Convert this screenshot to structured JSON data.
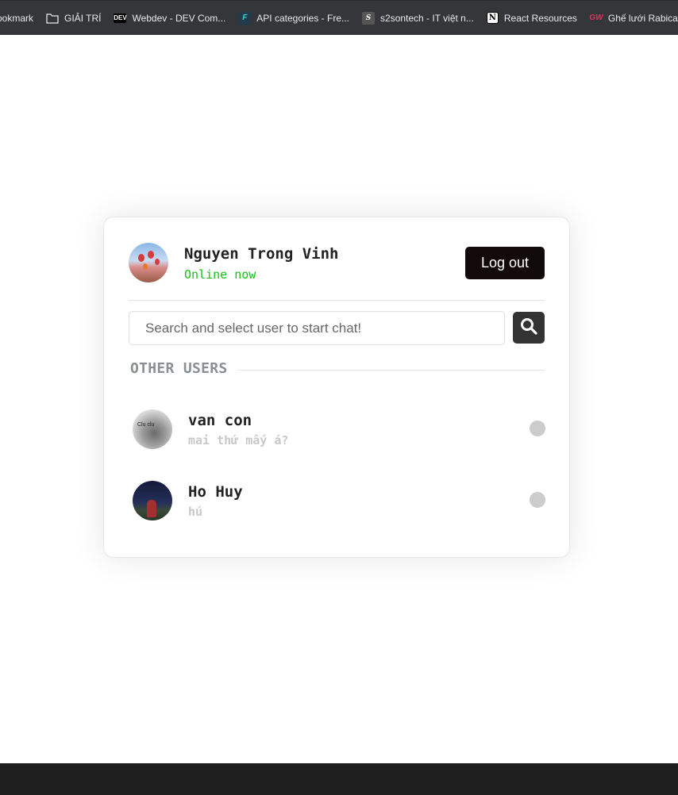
{
  "bookmarks": [
    {
      "label": "ookmark",
      "icon": "none"
    },
    {
      "label": "GIẢI TRÍ",
      "icon": "folder-icon"
    },
    {
      "label": "Webdev - DEV Com...",
      "icon": "dev-icon",
      "icon_text": "DEV"
    },
    {
      "label": "API categories - Fre...",
      "icon": "api-icon",
      "icon_text": "F"
    },
    {
      "label": "s2sontech - IT việt n...",
      "icon": "s2sontech-icon",
      "icon_text": "S"
    },
    {
      "label": "React Resources",
      "icon": "notion-icon",
      "icon_text": "N"
    },
    {
      "label": "Ghế lưới Rabica - C",
      "icon": "gw-icon",
      "icon_text": "GW"
    }
  ],
  "profile": {
    "name": "Nguyen Trong Vinh",
    "status": "Online now",
    "status_color": "#19c019",
    "logout_label": "Log out"
  },
  "search": {
    "placeholder": "Search and select user to start chat!",
    "value": ""
  },
  "section_title": "OTHER USERS",
  "users": [
    {
      "name": "van con",
      "last_message": "mai thứ mấy á?",
      "status": "offline",
      "avatar_text": "Clu clu"
    },
    {
      "name": "Ho Huy",
      "last_message": "hú",
      "status": "offline"
    }
  ]
}
